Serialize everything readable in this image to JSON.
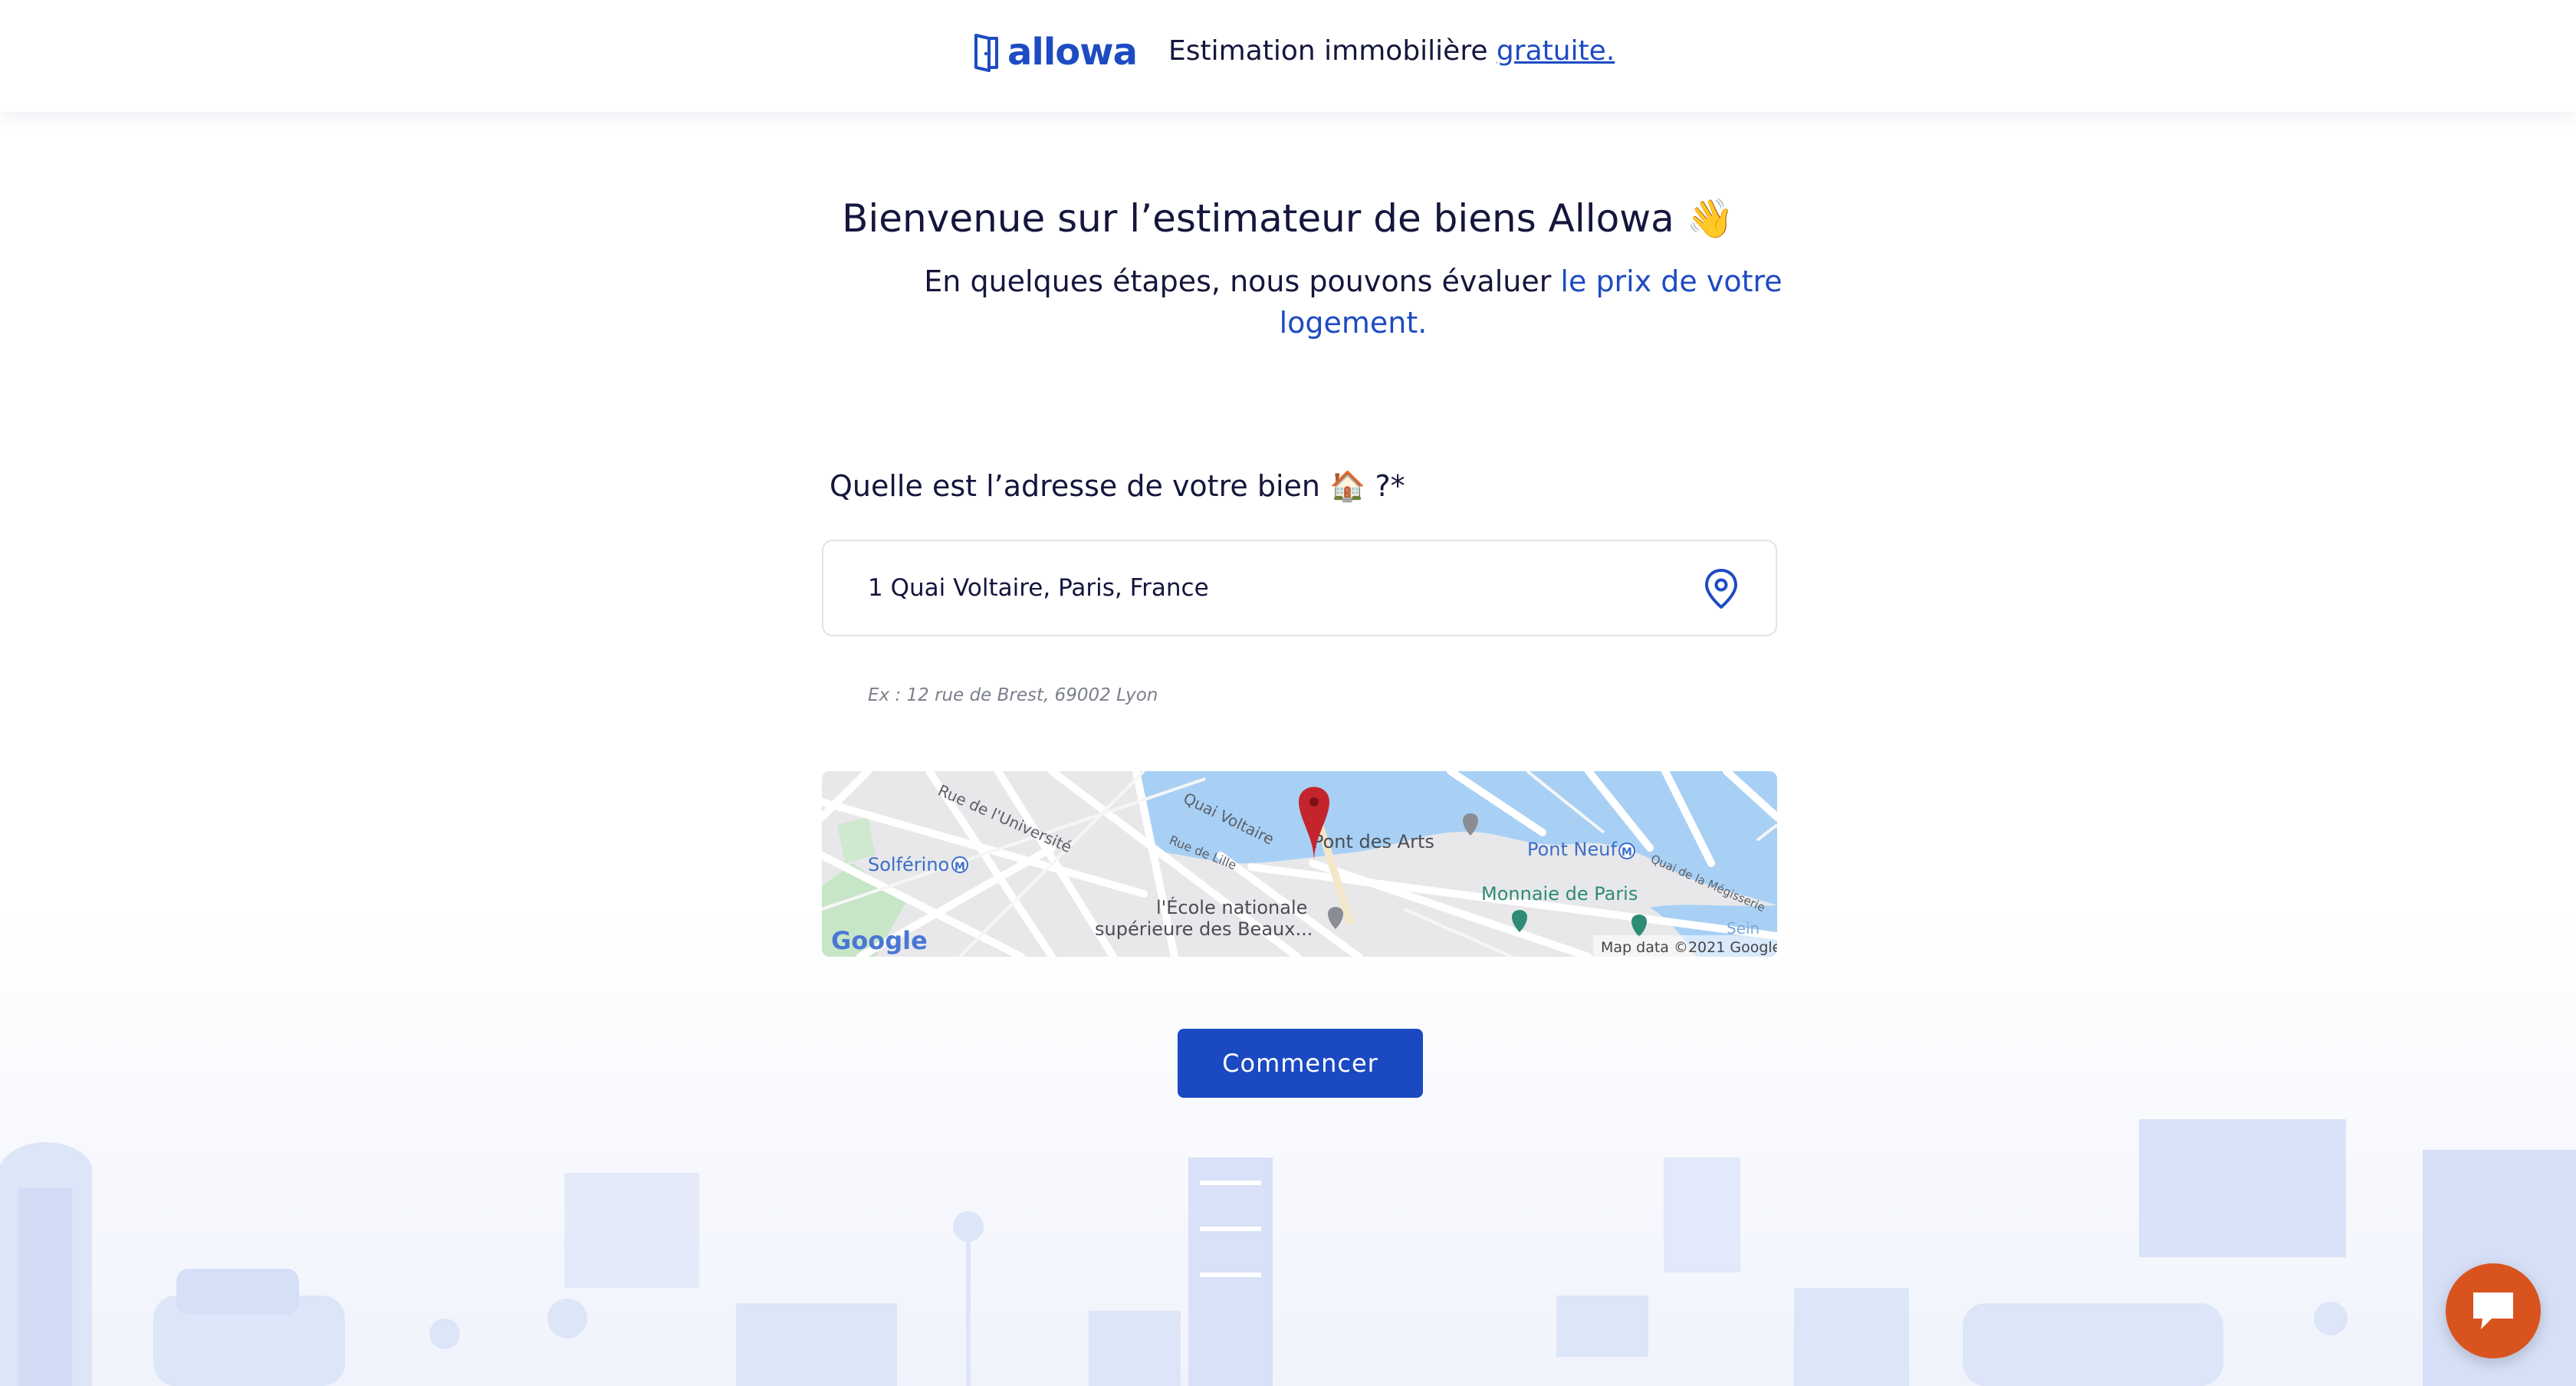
{
  "header": {
    "brand": "allowa",
    "tagline_text": "Estimation immobilière ",
    "tagline_link": "gratuite."
  },
  "welcome": {
    "title": "Bienvenue sur l’estimateur de biens Allowa 👋",
    "subtitle_text": "En quelques étapes, nous pouvons évaluer ",
    "subtitle_highlight": "le prix de votre logement."
  },
  "form": {
    "address_label": "Quelle est l’adresse de votre bien 🏠 ?*",
    "address_value": "1 Quai Voltaire, Paris, France",
    "address_hint": "Ex : 12 rue de Brest, 69002 Lyon",
    "submit_label": "Commencer"
  },
  "map": {
    "labels": {
      "rue_universite": "Rue de l'Université",
      "quai_voltaire": "Quai Voltaire",
      "rue_lille": "Rue de Lille",
      "solferino": "Solférino",
      "pont_des_arts": "Pont des Arts",
      "pont_neuf": "Pont Neuf",
      "quai_megisserie": "Quai de la Mégisserie",
      "monnaie": "Monnaie de Paris",
      "ecole_line1": "l'École nationale",
      "ecole_line2": "supérieure des Beaux...",
      "seine": "Sein",
      "google": "Google",
      "attribution": "Map data ©2021 Google"
    },
    "colors": {
      "water": "#a8d0f5",
      "land": "#e8e8ea",
      "park": "#c7e6c7",
      "pin": "#c4252c"
    }
  },
  "colors": {
    "brand": "#1d4bc2",
    "button": "#1a49c2",
    "chat": "#d9531e"
  },
  "icons": {
    "logo": "door-icon",
    "pin": "location-pin-icon",
    "chat": "chat-bubble-icon"
  }
}
